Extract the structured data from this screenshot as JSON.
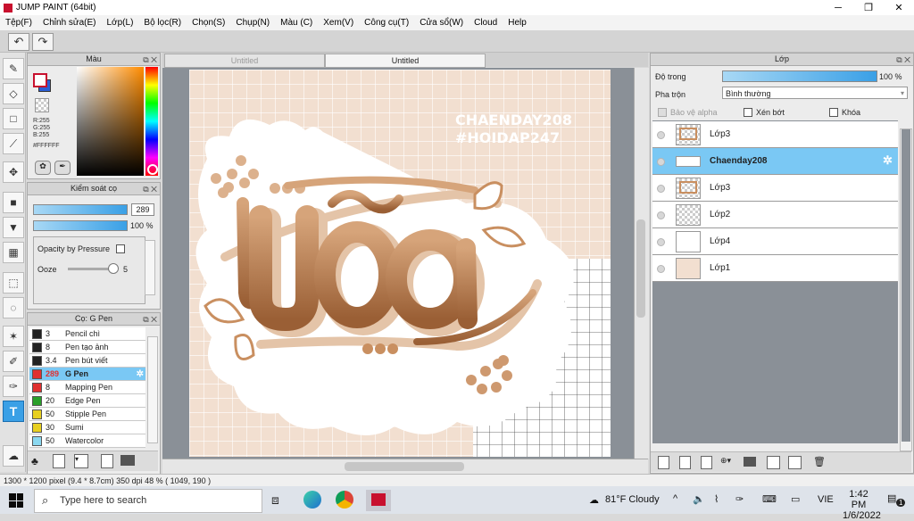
{
  "window": {
    "title": "JUMP PAINT (64bit)"
  },
  "menu": [
    "Tệp(F)",
    "Chỉnh sửa(E)",
    "Lớp(L)",
    "Bộ lọc(R)",
    "Chọn(S)",
    "Chụp(N)",
    "Màu (C)",
    "Xem(V)",
    "Công cụ(T)",
    "Cửa sổ(W)",
    "Cloud",
    "Help"
  ],
  "color_panel": {
    "title": "Màu",
    "r": "R:255",
    "g": "G:255",
    "b": "B:255",
    "hex": "#FFFFFF"
  },
  "brush_control": {
    "title": "Kiểm soát cọ",
    "size": "289",
    "opacity": "100 %",
    "pressure_label": "Opacity by Pressure",
    "ooze_label": "Ooze",
    "ooze_value": "5",
    "size_fill": 0.95,
    "opacity_fill": 1.0,
    "ooze_level": 0.5
  },
  "brush_list": {
    "title": "Cọ: G Pen",
    "items": [
      {
        "size": "3",
        "name": "Pencil chì",
        "color": "#222222"
      },
      {
        "size": "8",
        "name": "Pen tạo ảnh",
        "color": "#222222"
      },
      {
        "size": "3.4",
        "name": "Pen bút viết",
        "color": "#222222"
      },
      {
        "size": "289",
        "name": "G Pen",
        "color": "#e03030",
        "selected": true
      },
      {
        "size": "8",
        "name": "Mapping Pen",
        "color": "#e03030"
      },
      {
        "size": "20",
        "name": "Edge Pen",
        "color": "#2aa02a"
      },
      {
        "size": "50",
        "name": "Stipple Pen",
        "color": "#e8d020"
      },
      {
        "size": "30",
        "name": "Sumi",
        "color": "#e8d020"
      },
      {
        "size": "50",
        "name": "Watercolor",
        "color": "#8ad8f0"
      }
    ]
  },
  "tabs": [
    {
      "label": "Untitled",
      "active": false
    },
    {
      "label": "Untitled",
      "active": true
    }
  ],
  "canvas": {
    "watermark_line1": "CHAENDAY208",
    "watermark_line2": "#HOIDAP247",
    "art_text": "uõa"
  },
  "layer_panel": {
    "title": "Lớp",
    "opacity_label": "Độ trong",
    "opacity_value": "100 %",
    "opacity_fill": 1.0,
    "blend_label": "Pha trộn",
    "blend_value": "Bình thường",
    "protect_alpha": "Bảo vệ alpha",
    "clipping": "Xén bớt",
    "lock": "Khóa",
    "layers": [
      {
        "name": "Lớp3",
        "thumb": "art"
      },
      {
        "name": "Chaenday208",
        "thumb": "text",
        "selected": true
      },
      {
        "name": "Lớp3",
        "thumb": "art"
      },
      {
        "name": "Lớp2",
        "thumb": "checker"
      },
      {
        "name": "Lớp4",
        "thumb": "white"
      },
      {
        "name": "Lớp1",
        "thumb": "beige"
      }
    ]
  },
  "status": {
    "text": "1300 * 1200 pixel   (9.4 * 8.7cm)   350 dpi   48 %   ( 1049, 190 )"
  },
  "taskbar": {
    "search_placeholder": "Type here to search",
    "weather": "81°F  Cloudy",
    "lang": "VIE",
    "time": "1:42 PM",
    "date": "1/6/2022",
    "notif_count": "1"
  },
  "colors": {
    "accent": "#3aa0e6",
    "canvas_bg": "#f2dfd0",
    "brown": "#b87c4c"
  }
}
